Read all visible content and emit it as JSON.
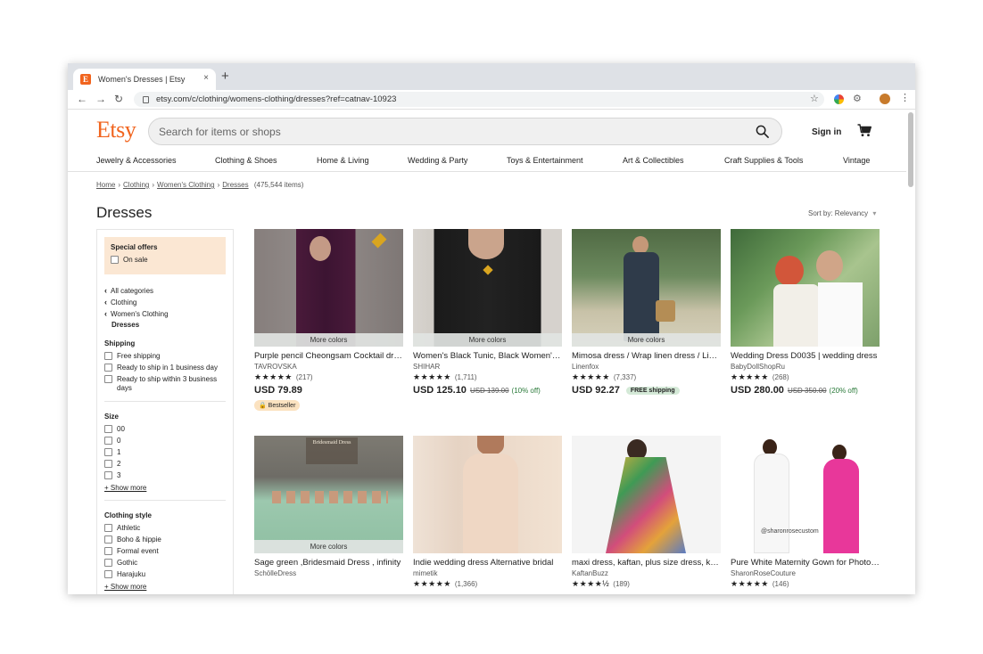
{
  "browser": {
    "tab_title": "Women's Dresses | Etsy",
    "favicon_letter": "E",
    "tab_close": "×",
    "new_tab": "+",
    "url": "etsy.com/c/clothing/womens-clothing/dresses?ref=catnav-10923",
    "icons": [
      "back-arrow-icon",
      "forward-arrow-icon",
      "reload-icon",
      "lock-icon",
      "star-icon",
      "extension-icon",
      "profile-avatar",
      "menu-dots-icon"
    ]
  },
  "header": {
    "logo": "Etsy",
    "search_placeholder": "Search for items or shops",
    "sign_in": "Sign in"
  },
  "categories": [
    "Jewelry & Accessories",
    "Clothing & Shoes",
    "Home & Living",
    "Wedding & Party",
    "Toys & Entertainment",
    "Art & Collectibles",
    "Craft Supplies & Tools",
    "Vintage"
  ],
  "breadcrumb": {
    "items": [
      "Home",
      "Clothing",
      "Women's Clothing",
      "Dresses"
    ],
    "count": "(475,544 items)"
  },
  "page_title": "Dresses",
  "sort_label": "Sort by: Relevancy",
  "sidebar": {
    "special_offers": "Special offers",
    "on_sale": "On sale",
    "categories": [
      "All categories",
      "Clothing",
      "Women's Clothing"
    ],
    "current_category": "Dresses",
    "shipping_title": "Shipping",
    "shipping_options": [
      "Free shipping",
      "Ready to ship in 1 business day",
      "Ready to ship within 3 business days"
    ],
    "size_title": "Size",
    "sizes": [
      "00",
      "0",
      "1",
      "2",
      "3"
    ],
    "show_more": "+ Show more",
    "style_title": "Clothing style",
    "styles": [
      "Athletic",
      "Boho & hippie",
      "Formal event",
      "Gothic",
      "Harajuku"
    ],
    "show_more_2": "+ Show more"
  },
  "products": [
    {
      "title": "Purple pencil Cheongsam Cocktail dress",
      "shop": "TAVROVSKA",
      "stars": "★★★★★",
      "reviews": "(217)",
      "price": "USD 79.89",
      "more_colors": "More colors",
      "badge": "🔒 Bestseller"
    },
    {
      "title": "Women's Black Tunic, Black Women's Dress",
      "shop": "SHIHAR",
      "stars": "★★★★★",
      "reviews": "(1,711)",
      "price": "USD 125.10",
      "original_price": "USD 139.00",
      "discount": "(10% off)",
      "more_colors": "More colors"
    },
    {
      "title": "Mimosa dress / Wrap linen dress / Linen",
      "shop": "Linenfox",
      "stars": "★★★★★",
      "reviews": "(7,337)",
      "price": "USD 92.27",
      "more_colors": "More colors",
      "shipping": "FREE shipping"
    },
    {
      "title": "Wedding Dress D0035 | wedding dress",
      "shop": "BabyDollShopRu",
      "stars": "★★★★★",
      "reviews": "(268)",
      "price": "USD 280.00",
      "original_price": "USD 350.00",
      "discount": "(20% off)"
    },
    {
      "title": "Sage green ,Bridesmaid Dress , infinity",
      "shop": "SchölleDress",
      "more_colors": "More colors",
      "image_caption": "Bridesmaid Dress"
    },
    {
      "title": "Indie wedding dress Alternative bridal",
      "shop": "mimetik",
      "stars": "★★★★★",
      "reviews": "(1,366)"
    },
    {
      "title": "maxi dress, kaftan, plus size dress, kaftan",
      "shop": "KaftanBuzz",
      "stars": "★★★★½",
      "reviews": "(189)"
    },
    {
      "title": "Pure White Maternity Gown for Photoshoot",
      "shop": "SharonRoseCouture",
      "stars": "★★★★★",
      "reviews": "(146)",
      "image_caption": "@sharonrosecustom"
    }
  ],
  "colors": {
    "brand": "#f1641e",
    "offers_bg": "#fbe7d3",
    "sale_green": "#2a7a3a"
  }
}
